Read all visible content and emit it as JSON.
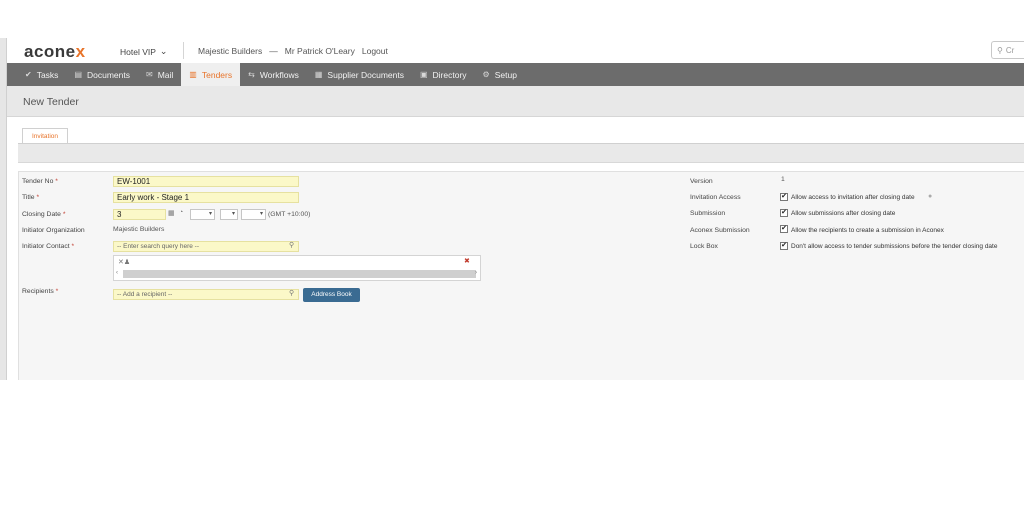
{
  "app": {
    "logo": "acone",
    "logo_x": "x",
    "project": "Hotel VIP",
    "organization": "Majestic Builders",
    "separator": "—",
    "user": "Mr Patrick O'Leary",
    "logout": "Logout",
    "search_placeholder": "Cr",
    "accent_color": "#e8742a"
  },
  "nav": {
    "tasks": "Tasks",
    "documents": "Documents",
    "mail": "Mail",
    "tenders": "Tenders",
    "workflows": "Workflows",
    "supplier_documents": "Supplier Documents",
    "directory": "Directory",
    "setup": "Setup"
  },
  "page": {
    "title": "New Tender",
    "tab": "Invitation"
  },
  "form": {
    "tender_no": {
      "label": "Tender No",
      "value": "EW-1001"
    },
    "title": {
      "label": "Title",
      "value": "Early work - Stage 1"
    },
    "closing_date": {
      "label": "Closing Date",
      "value": "3",
      "timezone": "(GMT +10:00)"
    },
    "initiator_org": {
      "label": "Initiator Organization",
      "value": "Majestic Builders"
    },
    "initiator_contact": {
      "label": "Initiator Contact",
      "placeholder": "-- Enter search query here --"
    },
    "recipients": {
      "label": "Recipients",
      "placeholder": "-- Add a recipient --",
      "button": "Address Book"
    },
    "required_mark": "*"
  },
  "settings": {
    "version": {
      "label": "Version",
      "value": "1"
    },
    "invitation_access": {
      "label": "Invitation Access",
      "option": "Allow access to invitation after closing date"
    },
    "submission": {
      "label": "Submission",
      "option": "Allow submissions after closing date"
    },
    "aconex_submission": {
      "label": "Aconex Submission",
      "option": "Allow the recipients to create a submission in Aconex"
    },
    "lock_box": {
      "label": "Lock Box",
      "option": "Don't allow access to tender submissions before the tender closing date"
    },
    "check_mark": "✔"
  }
}
